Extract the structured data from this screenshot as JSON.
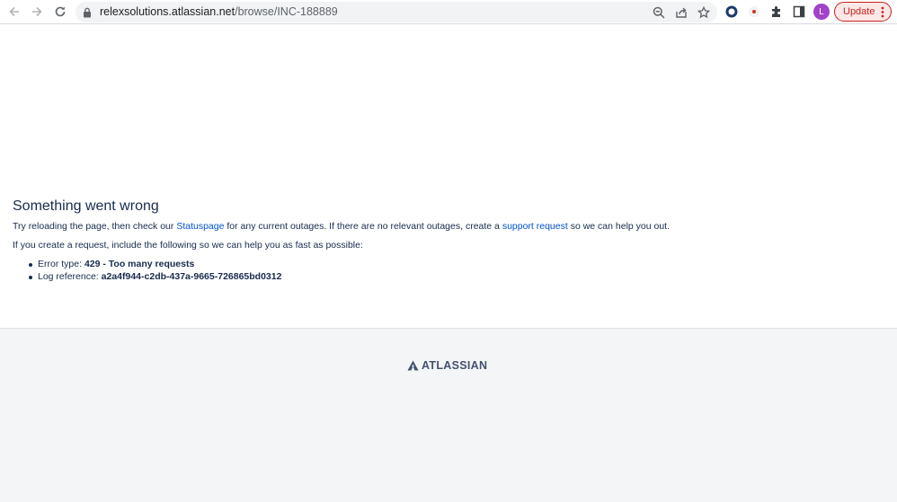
{
  "browser": {
    "url_host": "relexsolutions.atlassian.net",
    "url_path": "/browse/INC-188889",
    "avatar_letter": "L",
    "update_label": "Update",
    "icons": [
      "back-icon",
      "forward-icon",
      "reload-icon",
      "lock-icon",
      "zoom-icon",
      "share-icon",
      "star-icon",
      "extension-circle-icon",
      "extension-dot-icon",
      "puzzle-icon",
      "side-panel-icon",
      "more-icon"
    ]
  },
  "error": {
    "title": "Something went wrong",
    "line1_a": "Try reloading the page, then check our ",
    "line1_link1": "Statuspage",
    "line1_b": " for any current outages. If there are no relevant outages, create a ",
    "line1_link2": "support request",
    "line1_c": " so we can help you out.",
    "line2": "If you create a request, include the following so we can help you as fast as possible:",
    "items": [
      {
        "label": "Error type: ",
        "value": "429 - Too many requests"
      },
      {
        "label": "Log reference: ",
        "value": "a2a4f944-c2db-437a-9665-726865bd0312"
      }
    ]
  },
  "footer": {
    "brand": "ATLASSIAN"
  },
  "colors": {
    "link": "#0052cc",
    "text": "#172b4d",
    "footer_bg": "#f4f5f7",
    "update_red": "#c5221f",
    "avatar": "#a142c9"
  }
}
